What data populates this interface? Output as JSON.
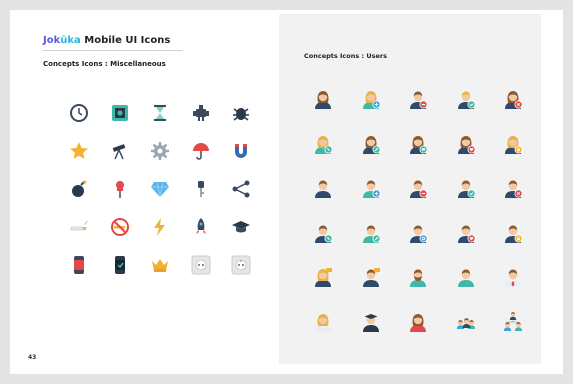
{
  "brand": {
    "part1": "Jok",
    "part2": "ūka",
    "rest": " Mobile UI Icons"
  },
  "left_section": {
    "title": "Concepts Icons : Miscellaneous",
    "icons": [
      [
        "clock-icon",
        "safe-icon",
        "hourglass-icon",
        "robot-icon",
        "bug-icon"
      ],
      [
        "star-icon",
        "telescope-icon",
        "gear-icon",
        "umbrella-icon",
        "magnet-icon"
      ],
      [
        "bomb-icon",
        "pushpin-icon",
        "diamond-icon",
        "key-icon",
        "share-icon"
      ],
      [
        "cigarette-icon",
        "no-smoking-icon",
        "lightning-icon",
        "rocket-icon",
        "graduation-cap-icon"
      ],
      [
        "smartwatch-icon",
        "smartwatch-dark-icon",
        "crown-icon",
        "power-socket-icon",
        "power-socket-alt-icon"
      ]
    ]
  },
  "right_section": {
    "title": "Concepts Icons : Users",
    "icons": [
      [
        "user-female-icon",
        "user-female-add-icon",
        "user-male-remove-icon",
        "user-male-check-icon",
        "user-female-delete-icon"
      ],
      [
        "user-female-phone-icon",
        "user-female-edit-icon",
        "user-female-chat-icon",
        "user-female-heart-icon",
        "user-female-lock-icon"
      ],
      [
        "user-male-icon",
        "user-male-add-icon",
        "user-male-remove-alt-icon",
        "user-male-check-alt-icon",
        "user-male-delete-icon"
      ],
      [
        "user-male-phone-icon",
        "user-male-edit-icon",
        "user-male-settings-icon",
        "user-male-heart-icon",
        "user-male-lock-icon"
      ],
      [
        "user-female-speech-icon",
        "user-male-speech-icon",
        "user-bearded-icon",
        "user-male-teal-icon",
        "user-business-icon"
      ],
      [
        "user-blonde-icon",
        "user-graduate-icon",
        "user-female-red-icon",
        "user-group-icon",
        "user-team-icon"
      ]
    ]
  },
  "page_number": "43",
  "colors": {
    "teal": "#3fb8a8",
    "skin": "#f2c9a0",
    "hair_brown": "#8a5a34",
    "hair_blonde": "#e8b24a",
    "navy": "#2f4a6a",
    "red": "#e24a4a",
    "blue": "#3ca0e0"
  }
}
